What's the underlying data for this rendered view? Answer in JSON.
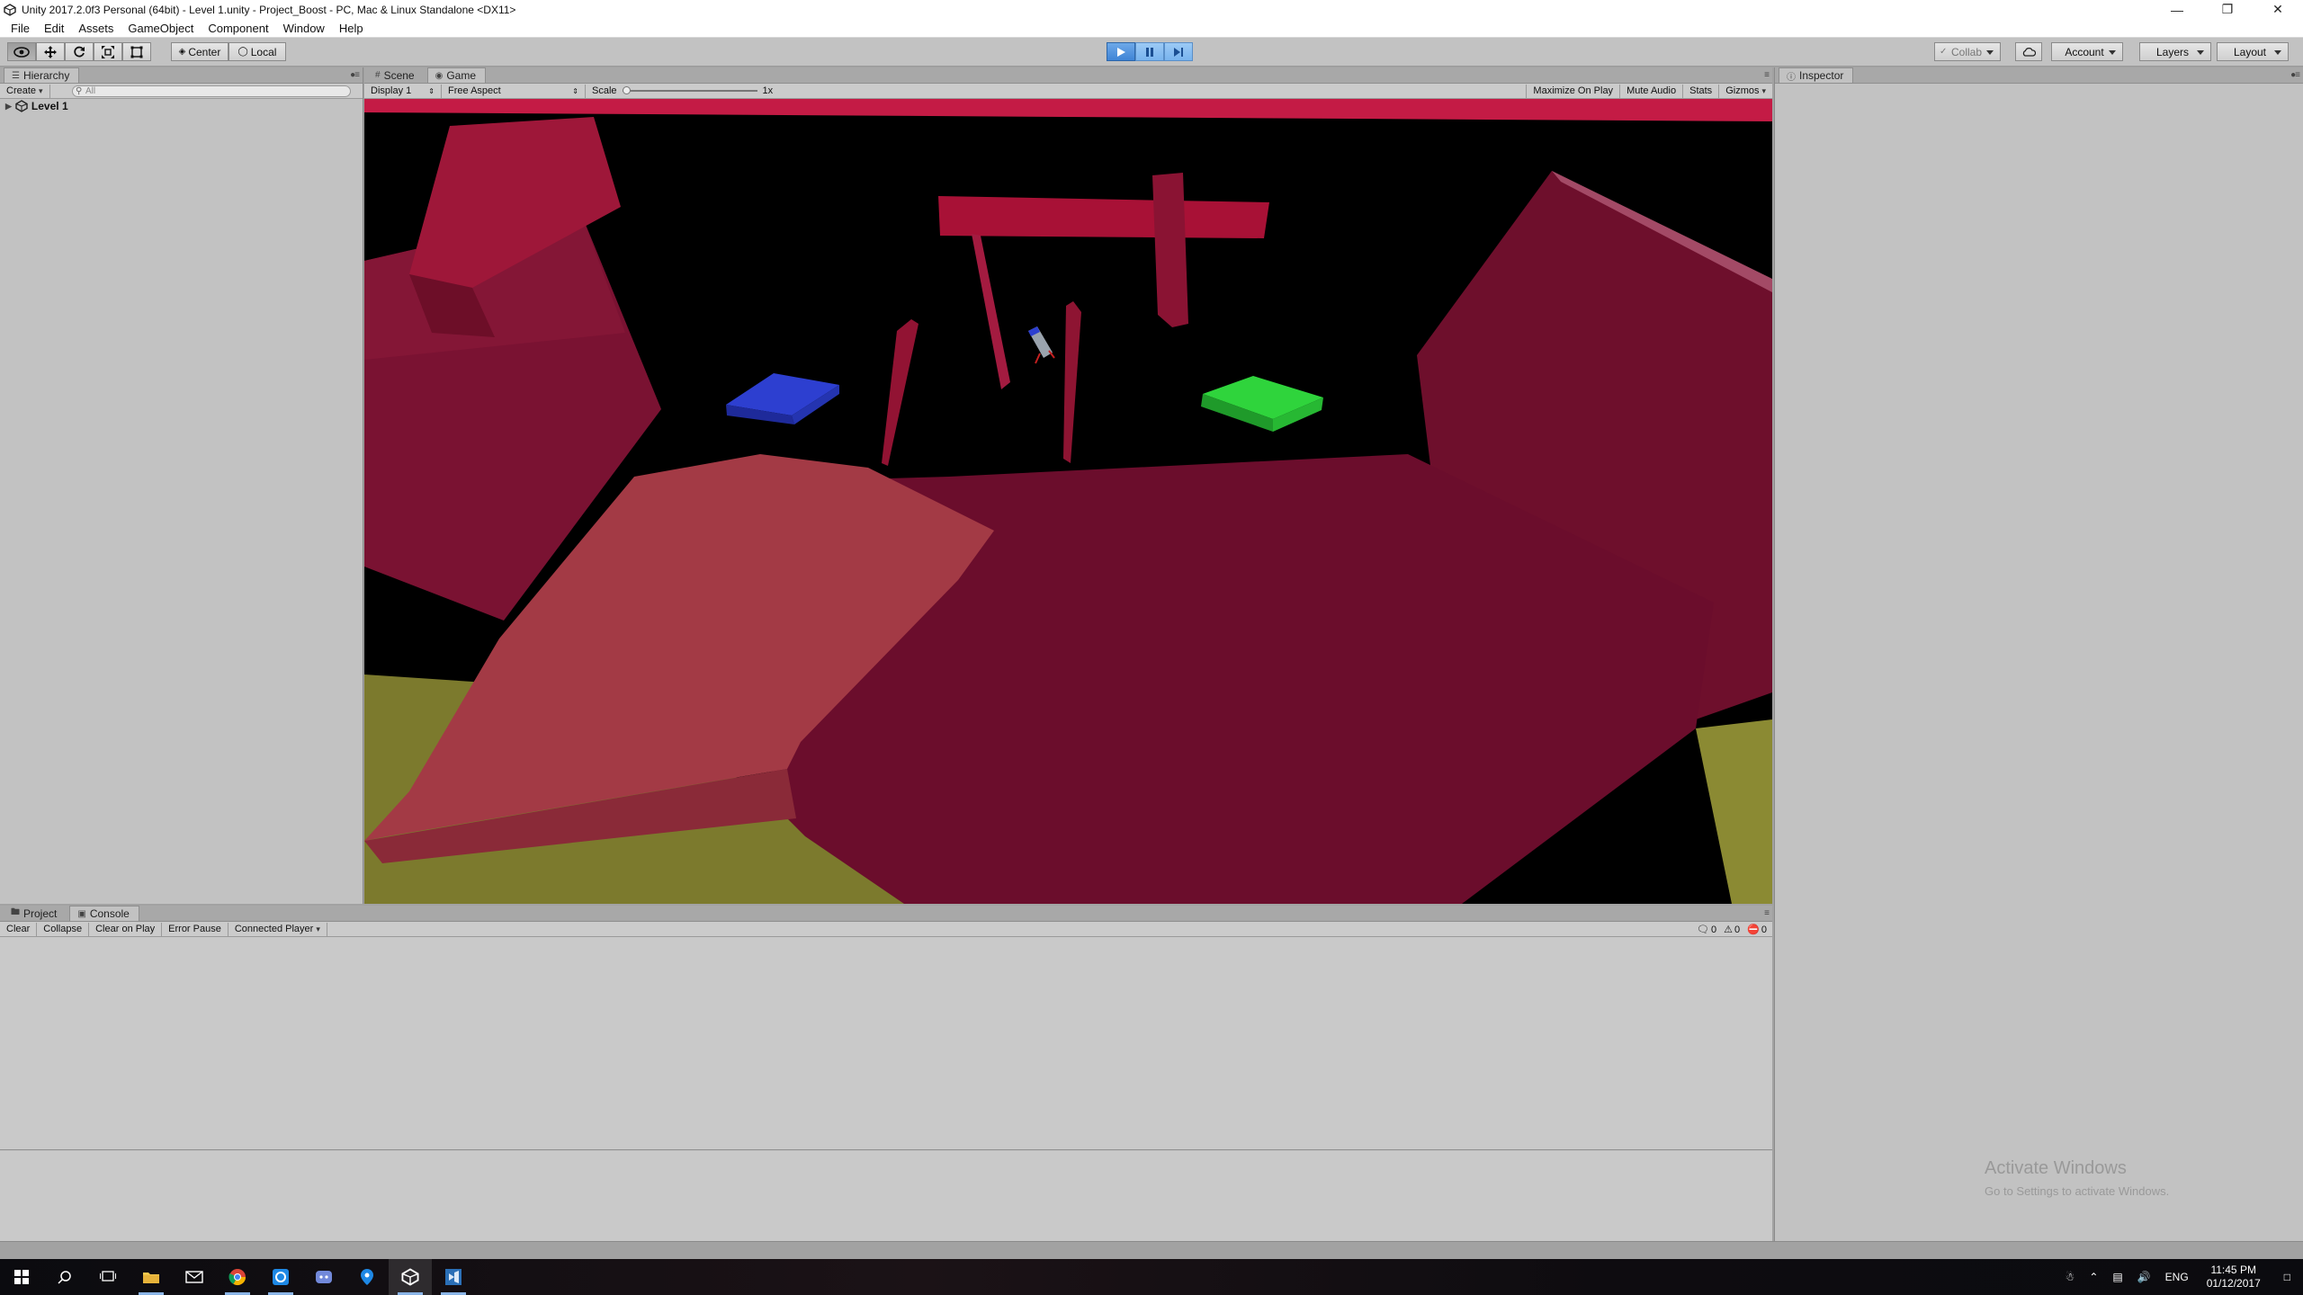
{
  "window": {
    "title": "Unity 2017.2.0f3 Personal (64bit) - Level 1.unity - Project_Boost - PC, Mac & Linux Standalone <DX11>",
    "controls": [
      "minimize-icon",
      "restore-icon",
      "close-icon"
    ]
  },
  "menu": [
    "File",
    "Edit",
    "Assets",
    "GameObject",
    "Component",
    "Window",
    "Help"
  ],
  "toolbar": {
    "tools": [
      "hand-tool-icon",
      "move-tool-icon",
      "rotate-tool-icon",
      "scale-tool-icon",
      "rect-tool-icon"
    ],
    "pivot_mode": "Center",
    "pivot_rotation": "Local",
    "playback": {
      "play": "play-icon",
      "pause": "pause-icon",
      "step": "step-icon",
      "playing": true
    },
    "collab": "Collab",
    "account": "Account",
    "layers": "Layers",
    "layout": "Layout"
  },
  "hierarchy": {
    "tab": "Hierarchy",
    "create": "Create",
    "search_placeholder": "All",
    "scene_name": "Level 1"
  },
  "view_tabs": {
    "scene": "Scene",
    "game": "Game"
  },
  "game_toolbar": {
    "display": "Display 1",
    "aspect": "Free Aspect",
    "scale_label": "Scale",
    "scale_value": "1x",
    "scale_level": 0,
    "maximize_on_play": "Maximize On Play",
    "mute_audio": "Mute Audio",
    "stats": "Stats",
    "gizmos": "Gizmos"
  },
  "game_scene": {
    "background": "#000000",
    "colors": {
      "obstacle": "#7a0f2e",
      "floor_light": "#a33a45",
      "ground": "#7c7a2d",
      "launch_pad": "#2b3cc4",
      "landing_pad": "#2ed23a",
      "rocket": "#9aa3ad"
    }
  },
  "inspector": {
    "tab": "Inspector"
  },
  "bottom_tabs": {
    "project": "Project",
    "console": "Console"
  },
  "console": {
    "buttons": [
      "Clear",
      "Collapse",
      "Clear on Play",
      "Error Pause",
      "Connected Player"
    ],
    "log_count": "0",
    "warning_count": "0",
    "error_count": "0"
  },
  "watermark": {
    "line1": "Activate Windows",
    "line2": "Go to Settings to activate Windows."
  },
  "taskbar": {
    "apps": [
      "windows-start-icon",
      "search-icon",
      "task-view-icon",
      "file-explorer-icon",
      "mail-icon",
      "chrome-icon",
      "app-icon",
      "discord-icon",
      "maps-icon",
      "unity-icon",
      "visual-studio-icon"
    ],
    "tray": {
      "language": "ENG",
      "time": "11:45 PM",
      "date": "01/12/2017"
    }
  }
}
